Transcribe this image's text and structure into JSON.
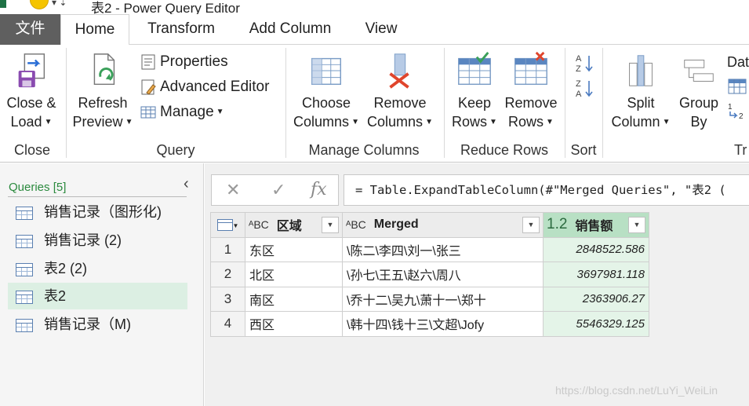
{
  "window": {
    "title": "表2 - Power Query Editor",
    "qat_glyph": "▾  ⇣"
  },
  "tabs": [
    {
      "label": "文件"
    },
    {
      "label": "Home"
    },
    {
      "label": "Transform"
    },
    {
      "label": "Add Column"
    },
    {
      "label": "View"
    }
  ],
  "ribbon": {
    "close_group": {
      "label": "Close",
      "close_load_l1": "Close &",
      "close_load_l2": "Load"
    },
    "query_group": {
      "label": "Query",
      "refresh_l1": "Refresh",
      "refresh_l2": "Preview",
      "properties": "Properties",
      "advanced_editor": "Advanced Editor",
      "manage": "Manage"
    },
    "manage_columns_group": {
      "label": "Manage Columns",
      "choose_l1": "Choose",
      "choose_l2": "Columns",
      "remove_l1": "Remove",
      "remove_l2": "Columns"
    },
    "reduce_rows_group": {
      "label": "Reduce Rows",
      "keep_l1": "Keep",
      "keep_l2": "Rows",
      "remove_l1": "Remove",
      "remove_l2": "Rows"
    },
    "sort_group": {
      "label": "Sort"
    },
    "transform_group": {
      "label": "Tr",
      "split_l1": "Split",
      "split_l2": "Column",
      "group_l1": "Group",
      "group_l2": "By",
      "datatype_partial": "Dat"
    }
  },
  "queries_pane": {
    "header": "Queries [5]",
    "collapse_glyph": "‹",
    "items": [
      {
        "label": "销售记录（图形化)"
      },
      {
        "label": "销售记录 (2)"
      },
      {
        "label": "表2 (2)"
      },
      {
        "label": "表2"
      },
      {
        "label": "销售记录（M)"
      }
    ]
  },
  "formula_bar": {
    "cancel_glyph": "✕",
    "commit_glyph": "✓",
    "fx_glyph": "fx",
    "formula": "= Table.ExpandTableColumn(#\"Merged Queries\", \"表2 ("
  },
  "grid": {
    "columns": [
      {
        "type_icon": "ᴬBC",
        "name": "区域"
      },
      {
        "type_icon": "ᴬBC",
        "name": "Merged"
      },
      {
        "type_icon": "1.2",
        "name": "销售额"
      }
    ],
    "rows": [
      {
        "n": "1",
        "region": "东区",
        "merged": "\\陈二\\李四\\刘一\\张三",
        "sales": "2848522.586"
      },
      {
        "n": "2",
        "region": "北区",
        "merged": "\\孙七\\王五\\赵六\\周八",
        "sales": "3697981.118"
      },
      {
        "n": "3",
        "region": "南区",
        "merged": "\\乔十二\\吴九\\萧十一\\郑十",
        "sales": "2363906.27"
      },
      {
        "n": "4",
        "region": "西区",
        "merged": "\\韩十四\\钱十三\\文超\\Jofy",
        "sales": "5546329.125"
      }
    ]
  },
  "watermark": "https://blog.csdn.net/LuYi_WeiLin",
  "colors": {
    "file_tab": "#5f5f5f",
    "selected_query": "#dcefe3",
    "number_column_header": "#b8e0c4",
    "number_column_cells": "#e4f4e8",
    "queries_header": "#2b8a3e"
  }
}
